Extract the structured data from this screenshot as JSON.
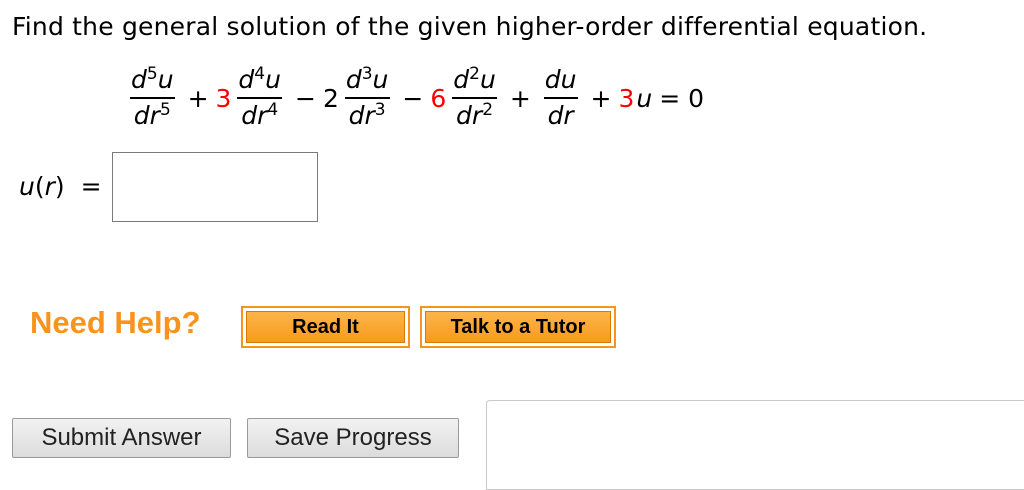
{
  "question": {
    "text": "Find the general solution of the given higher-order differential equation."
  },
  "equation": {
    "term1": {
      "num_base": "d",
      "num_exp": "5",
      "num_var": "u",
      "den_base": "dr",
      "den_exp": "5"
    },
    "op1": "+",
    "coef2": "3",
    "term2": {
      "num_base": "d",
      "num_exp": "4",
      "num_var": "u",
      "den_base": "dr",
      "den_exp": "4"
    },
    "op2": "−",
    "coef3": "2",
    "term3": {
      "num_base": "d",
      "num_exp": "3",
      "num_var": "u",
      "den_base": "dr",
      "den_exp": "3"
    },
    "op3": "−",
    "coef4": "6",
    "term4": {
      "num_base": "d",
      "num_exp": "2",
      "num_var": "u",
      "den_base": "dr",
      "den_exp": "2"
    },
    "op4": "+",
    "term5": {
      "num": "du",
      "den": "dr"
    },
    "op5": "+",
    "coef6": "3",
    "var6": "u",
    "rhs": "= 0"
  },
  "answer": {
    "fn": "u",
    "arg": "(r)",
    "arg_open": "(",
    "arg_var": "r",
    "arg_close": ")",
    "equals": "=",
    "value": ""
  },
  "help": {
    "label": "Need Help?",
    "read_it": "Read It",
    "talk_to_tutor": "Talk to a Tutor"
  },
  "form": {
    "submit_label": "Submit Answer",
    "save_label": "Save Progress"
  },
  "colors": {
    "highlight": "#ff0000",
    "help_orange": "#f7941d"
  }
}
